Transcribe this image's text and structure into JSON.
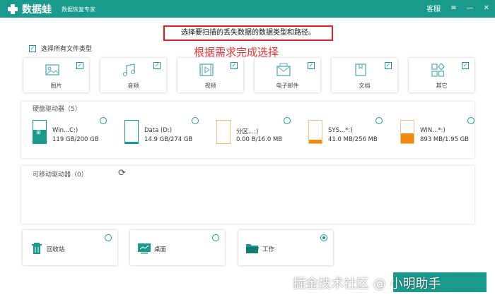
{
  "app": {
    "name": "数据蛙",
    "subtitle": "数据恢复专家"
  },
  "titlebar": {
    "service": "客服",
    "menu_icon": "≡",
    "minimize_icon": "—",
    "close_icon": "✕"
  },
  "prompt": {
    "instruction": "选择要扫描的丢失数据的数据类型和路径。",
    "annotation": "根据需求完成选择"
  },
  "select_all": {
    "label": "选择所有文件类型",
    "checked": true
  },
  "file_types": [
    {
      "label": "图片",
      "icon": "image-icon",
      "checked": true
    },
    {
      "label": "音频",
      "icon": "music-icon",
      "checked": true
    },
    {
      "label": "视频",
      "icon": "video-icon",
      "checked": true
    },
    {
      "label": "电子邮件",
      "icon": "mail-icon",
      "checked": true
    },
    {
      "label": "文档",
      "icon": "document-icon",
      "checked": true
    },
    {
      "label": "其它",
      "icon": "other-icon",
      "checked": true
    }
  ],
  "hard_drives": {
    "title": "硬盘驱动器（5）",
    "items": [
      {
        "name": "Win...C:)",
        "size": "119 GB/200 GB",
        "used_fraction": 0.6,
        "color": "#1a9a8c",
        "os": true
      },
      {
        "name": "Data (D:)",
        "size": "14.9 GB/274 GB",
        "used_fraction": 0.05,
        "color": "#1a9a8c",
        "os": false
      },
      {
        "name": "分区...:)",
        "size": "0.00  B/16.0 MB",
        "used_fraction": 0.0,
        "color": "#f0a030",
        "os": false
      },
      {
        "name": "SYS...*:)",
        "size": "41.0 MB/256 MB",
        "used_fraction": 0.16,
        "color": "#f08a10",
        "os": false
      },
      {
        "name": "WIN...*:)",
        "size": "893 MB/1.95 GB",
        "used_fraction": 0.45,
        "color": "#f08a10",
        "os": false
      }
    ]
  },
  "removable": {
    "title": "可移动驱动器（0）"
  },
  "locations": [
    {
      "label": "回收站",
      "icon": "recycle-bin-icon",
      "selected": false
    },
    {
      "label": "桌面",
      "icon": "desktop-icon",
      "selected": false
    },
    {
      "label": "工作",
      "icon": "folder-icon",
      "selected": true
    }
  ],
  "watermark": "掘金技术社区 @ 小明助手",
  "colors": {
    "accent": "#1a9a8c",
    "highlight": "#e02020",
    "warning": "#f08a10"
  }
}
